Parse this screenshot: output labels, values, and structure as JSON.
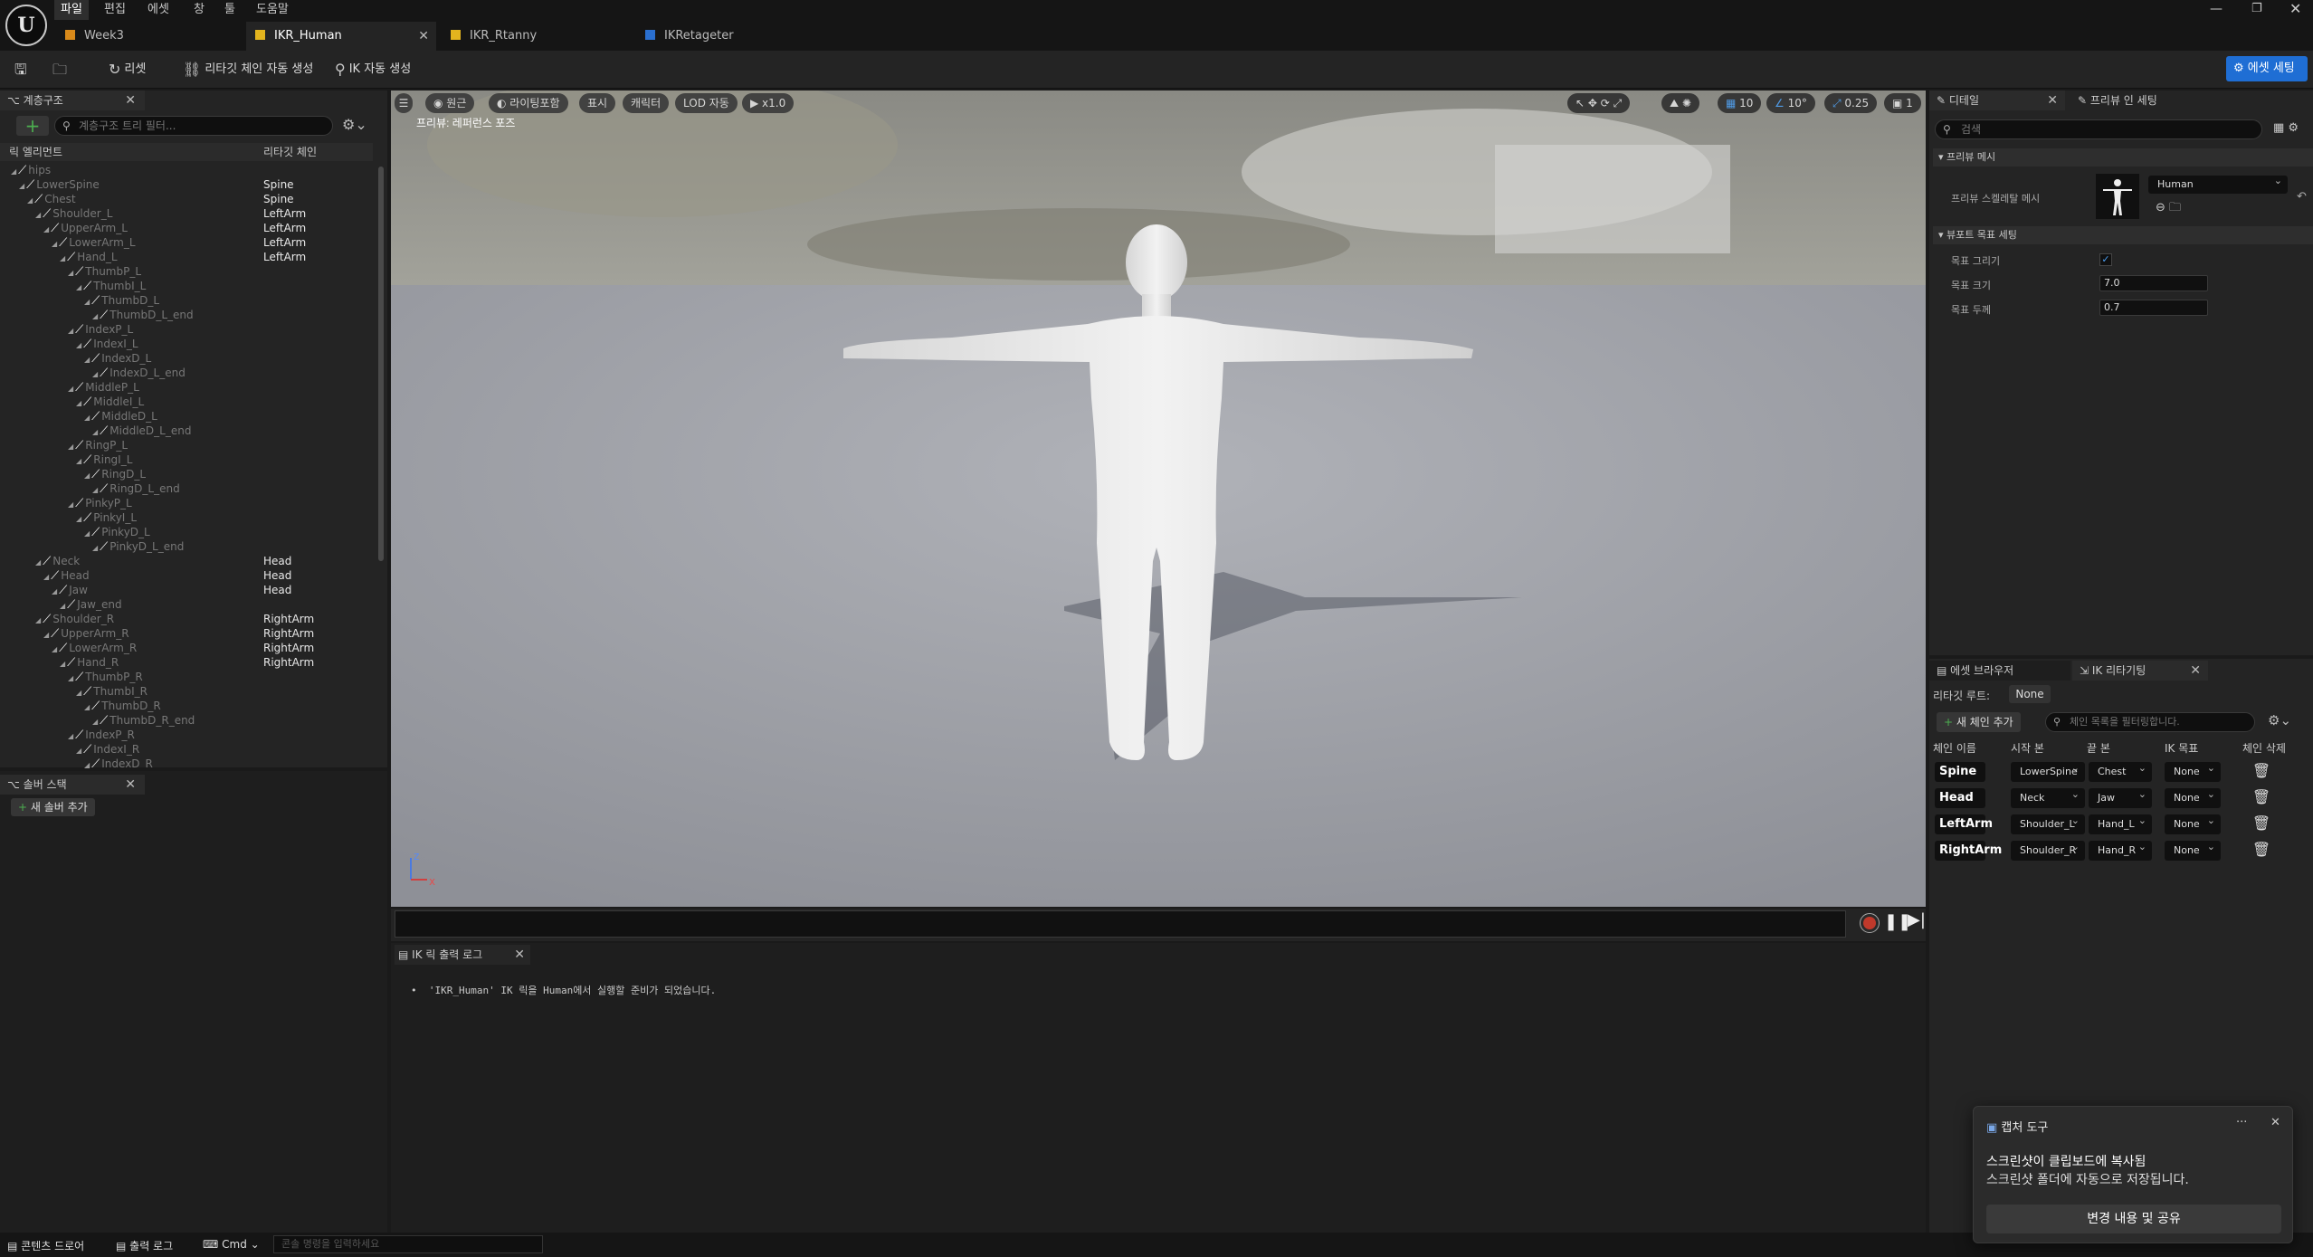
{
  "menus": [
    "파일",
    "편집",
    "에셋",
    "창",
    "툴",
    "도움말"
  ],
  "tabs": [
    {
      "label": "Week3"
    },
    {
      "label": "IKR_Human"
    },
    {
      "label": "IKR_Rtanny"
    },
    {
      "label": "IKRetageter"
    }
  ],
  "toolbar": {
    "reset": "리셋",
    "auto_chain": "리타깃 체인 자동 생성",
    "auto_ik": "IK 자동 생성",
    "asset_settings": "에셋 세팅"
  },
  "hierarchy": {
    "title": "계층구조",
    "filter_placeholder": "계층구조 트리 필터...",
    "col_rig": "릭 엘리먼트",
    "col_chain": "리타깃 체인",
    "bones": [
      {
        "name": "hips",
        "chain": ""
      },
      {
        "name": "LowerSpine",
        "chain": "Spine"
      },
      {
        "name": "Chest",
        "chain": "Spine"
      },
      {
        "name": "Shoulder_L",
        "chain": "LeftArm"
      },
      {
        "name": "UpperArm_L",
        "chain": "LeftArm"
      },
      {
        "name": "LowerArm_L",
        "chain": "LeftArm"
      },
      {
        "name": "Hand_L",
        "chain": "LeftArm"
      },
      {
        "name": "ThumbP_L",
        "chain": ""
      },
      {
        "name": "ThumbI_L",
        "chain": ""
      },
      {
        "name": "ThumbD_L",
        "chain": ""
      },
      {
        "name": "ThumbD_L_end",
        "chain": ""
      },
      {
        "name": "IndexP_L",
        "chain": ""
      },
      {
        "name": "IndexI_L",
        "chain": ""
      },
      {
        "name": "IndexD_L",
        "chain": ""
      },
      {
        "name": "IndexD_L_end",
        "chain": ""
      },
      {
        "name": "MiddleP_L",
        "chain": ""
      },
      {
        "name": "MiddleI_L",
        "chain": ""
      },
      {
        "name": "MiddleD_L",
        "chain": ""
      },
      {
        "name": "MiddleD_L_end",
        "chain": ""
      },
      {
        "name": "RingP_L",
        "chain": ""
      },
      {
        "name": "RingI_L",
        "chain": ""
      },
      {
        "name": "RingD_L",
        "chain": ""
      },
      {
        "name": "RingD_L_end",
        "chain": ""
      },
      {
        "name": "PinkyP_L",
        "chain": ""
      },
      {
        "name": "PinkyI_L",
        "chain": ""
      },
      {
        "name": "PinkyD_L",
        "chain": ""
      },
      {
        "name": "PinkyD_L_end",
        "chain": ""
      },
      {
        "name": "Neck",
        "chain": "Head"
      },
      {
        "name": "Head",
        "chain": "Head"
      },
      {
        "name": "Jaw",
        "chain": "Head"
      },
      {
        "name": "Jaw_end",
        "chain": ""
      },
      {
        "name": "Shoulder_R",
        "chain": "RightArm"
      },
      {
        "name": "UpperArm_R",
        "chain": "RightArm"
      },
      {
        "name": "LowerArm_R",
        "chain": "RightArm"
      },
      {
        "name": "Hand_R",
        "chain": "RightArm"
      },
      {
        "name": "ThumbP_R",
        "chain": ""
      },
      {
        "name": "ThumbI_R",
        "chain": ""
      },
      {
        "name": "ThumbD_R",
        "chain": ""
      },
      {
        "name": "ThumbD_R_end",
        "chain": ""
      },
      {
        "name": "IndexP_R",
        "chain": ""
      },
      {
        "name": "IndexI_R",
        "chain": ""
      },
      {
        "name": "IndexD_R",
        "chain": ""
      }
    ]
  },
  "solver": {
    "title": "솔버 스택",
    "add": "새 솔버 추가"
  },
  "viewport": {
    "perspective": "원근",
    "lighting": "라이팅포함",
    "show": "표시",
    "character": "캐릭터",
    "lod": "LOD 자동",
    "speed": "x1.0",
    "preview_label": "프리뷰: 레퍼런스 포즈",
    "grid": "10",
    "angle": "10°",
    "scale": "0.25",
    "cam": "1",
    "axis_z": "z",
    "axis_x": "x"
  },
  "log": {
    "title": "IK 릭 출력 로그",
    "message": "'IKR_Human' IK 릭을 Human에서 실행할 준비가 되었습니다."
  },
  "details": {
    "tab1": "디테일",
    "tab2": "프리뷰 인 세팅",
    "search_placeholder": "검색",
    "section_preview": "프리뷰 메시",
    "preview_mesh_label": "프리뷰 스켈레탈 메시",
    "mesh_value": "Human",
    "section_goal": "뷰포트 목표 세팅",
    "draw_goal": "목표 그리기",
    "goal_size": "목표 크기",
    "goal_size_value": "7.0",
    "goal_thickness": "목표 두께",
    "goal_thickness_value": "0.7"
  },
  "retargeting": {
    "tab1": "에셋 브라우저",
    "tab2": "IK 리타기팅",
    "root_label": "리타깃 루트:",
    "root_value": "None",
    "add_chain": "새 체인 추가",
    "filter_placeholder": "체인 목록을 필터링합니다.",
    "cols": [
      "체인 이름",
      "시작 본",
      "끝 본",
      "IK 목표",
      "체인 삭제"
    ],
    "chains": [
      {
        "name": "Spine",
        "start": "LowerSpine",
        "end": "Chest",
        "goal": "None"
      },
      {
        "name": "Head",
        "start": "Neck",
        "end": "Jaw",
        "goal": "None"
      },
      {
        "name": "LeftArm",
        "start": "Shoulder_L",
        "end": "Hand_L",
        "goal": "None"
      },
      {
        "name": "RightArm",
        "start": "Shoulder_R",
        "end": "Hand_R",
        "goal": "None"
      }
    ]
  },
  "bottombar": {
    "content_drawer": "콘텐츠 드로어",
    "output_log": "출력 로그",
    "cmd": "Cmd",
    "cmd_placeholder": "콘솔 명령을 입력하세요"
  },
  "toast": {
    "title": "캡처 도구",
    "line1": "스크린샷이 클립보드에 복사됨",
    "line2": "스크린샷 폴더에 자동으로 저장됩니다.",
    "button": "변경 내용 및 공유"
  },
  "colors": {
    "accent": "#1f6ed4",
    "bg": "#1a1a1a",
    "panel": "#242424"
  }
}
